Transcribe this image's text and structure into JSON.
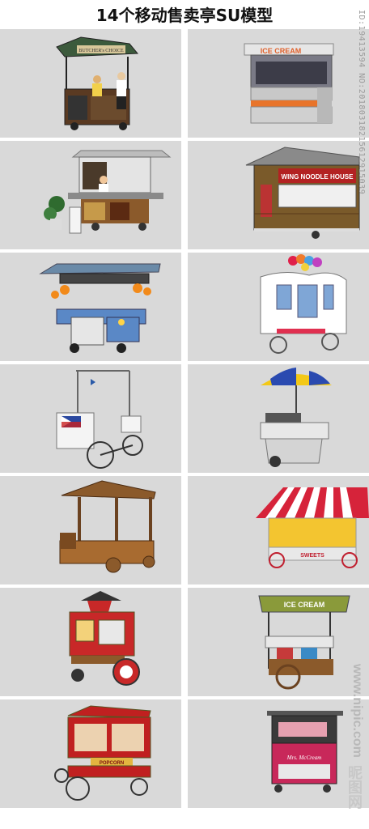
{
  "title": "14个移动售卖亭SU模型",
  "watermark_id": "ID:19413594 NO:20180318215612915039",
  "watermark_url": "www.nipic.com",
  "watermark_logo": "昵图网",
  "models": [
    {
      "name": "butcher-stand",
      "sign": "BUTCHER's CHOICE"
    },
    {
      "name": "ice-cream-kiosk",
      "sign": "ICE CREAM"
    },
    {
      "name": "food-cart-with-plant",
      "sign": ""
    },
    {
      "name": "wing-noodle-house",
      "sign": "WING NOODLE HOUSE"
    },
    {
      "name": "orange-juice-cart",
      "sign": ""
    },
    {
      "name": "balloon-carriage",
      "sign": ""
    },
    {
      "name": "philippine-bike-cart",
      "sign": ""
    },
    {
      "name": "umbrella-hot-dog-cart",
      "sign": ""
    },
    {
      "name": "wooden-market-stall",
      "sign": ""
    },
    {
      "name": "striped-awning-sweets-cart",
      "sign": "SWEETS"
    },
    {
      "name": "red-vintage-cart",
      "sign": ""
    },
    {
      "name": "ice-cream-wheel-cart",
      "sign": "ICE CREAM"
    },
    {
      "name": "red-popcorn-wagon",
      "sign": "POPCORN"
    },
    {
      "name": "mrs-mccream-cart",
      "sign": "Mrs. McCream"
    }
  ]
}
